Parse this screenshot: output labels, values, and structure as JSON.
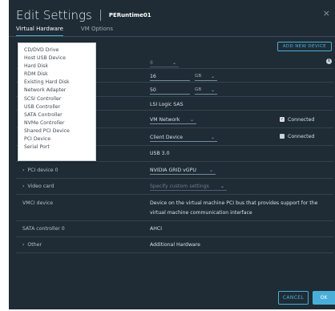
{
  "header": {
    "title": "Edit Settings",
    "vm_name": "PERuntime01",
    "close_glyph": "×"
  },
  "tabs": [
    {
      "label": "Virtual Hardware",
      "active": true
    },
    {
      "label": "VM Options",
      "active": false
    }
  ],
  "toolbar": {
    "add_new_device_label": "ADD NEW DEVICE",
    "info_glyph": "i"
  },
  "hardware": {
    "cpu": {
      "value": "8"
    },
    "memory": {
      "value": "16",
      "unit": "GB"
    },
    "hard_disk": {
      "value": "50",
      "unit": "GB"
    },
    "scsi_controller": {
      "value": "LSI Logic SAS"
    },
    "network_adapter": {
      "value": "VM Network",
      "connected_label": "Connected",
      "connected": true
    },
    "cd_dvd": {
      "value": "Client Device",
      "connected_label": "Connected",
      "connected": false
    },
    "usb_controller": {
      "value": "USB 3.0"
    },
    "pci_device": {
      "label": "PCI device 0",
      "value": "NVIDIA GRID vGPU"
    },
    "video_card": {
      "label": "Video card",
      "value": "Specify custom settings"
    },
    "vmci": {
      "label": "VMCI device",
      "description_line1": "Device on the virtual machine PCI bus that provides support for the",
      "description_line2": "virtual machine communication interface"
    },
    "sata": {
      "label": "SATA controller 0",
      "value": "AHCI"
    },
    "other": {
      "label": "Other",
      "value": "Additional Hardware"
    }
  },
  "add_device_menu": {
    "items": [
      "CD/DVD Drive",
      "Host USB Device",
      "Hard Disk",
      "RDM Disk",
      "Existing Hard Disk",
      "Network Adapter",
      "SCSI Controller",
      "USB Controller",
      "SATA Controller",
      "NVMe Controller",
      "Shared PCI Device",
      "PCI Device",
      "Serial Port"
    ]
  },
  "footer": {
    "cancel_label": "CANCEL",
    "ok_label": "OK"
  },
  "colors": {
    "dialog_bg": "#1f2c35",
    "accent": "#49afd9",
    "menu_bg": "#ffffff"
  }
}
